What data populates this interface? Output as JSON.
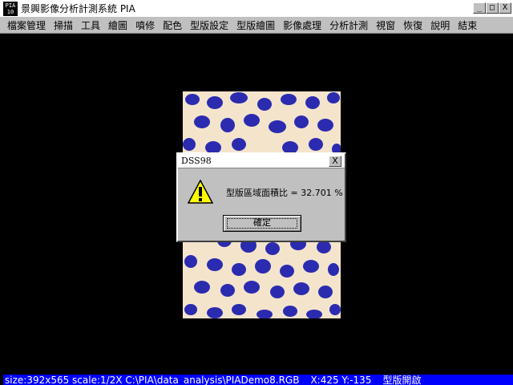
{
  "window": {
    "icon_top": "PIA",
    "icon_bottom": "10",
    "title": "景興影像分析計測系統 PIA",
    "minimize_glyph": "_",
    "maximize_glyph": "□",
    "close_glyph": "X"
  },
  "menu": {
    "items": [
      "檔案管理",
      "掃描",
      "工具",
      "繪圖",
      "噴修",
      "配色",
      "型版設定",
      "型版繪圖",
      "影像處理",
      "分析計測",
      "視窗",
      "恢復",
      "說明",
      "結束"
    ]
  },
  "dialog": {
    "title": "DSS98",
    "close_glyph": "X",
    "icon": "warning-icon",
    "message": "型版區域面積比 = 32.701 %",
    "ok_label": "確定"
  },
  "statusbar": {
    "info": "size:392x565 scale:1/2X C:\\PIA\\data_analysis\\PIADemo8.RGB",
    "coords": "X:425 Y:-135",
    "mode": "型版開啟"
  },
  "colors": {
    "spot": "#2b2bb0",
    "fur": "#f4e4cc",
    "status_bg": "#0000ff"
  }
}
